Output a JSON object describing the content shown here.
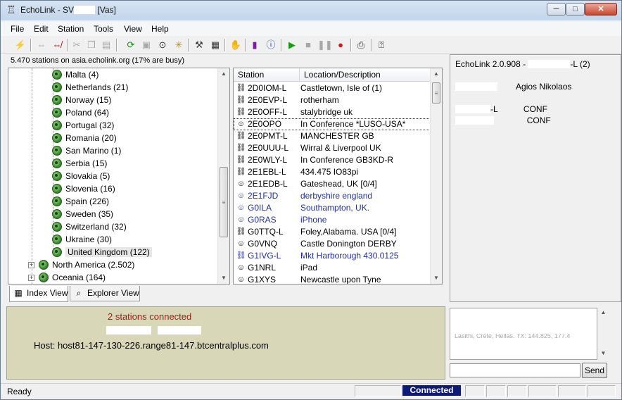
{
  "window": {
    "title_prefix": "EchoLink - SV",
    "title_suffix": "[Vas]",
    "minimize_glyph": "─",
    "maximize_glyph": "□",
    "close_glyph": "✕"
  },
  "menu": [
    "File",
    "Edit",
    "Station",
    "Tools",
    "View",
    "Help"
  ],
  "toolbar_icons": [
    "lightning-icon",
    "link-icon",
    "unlink-icon",
    "cut-icon",
    "copy-icon",
    "paste-icon",
    "refresh-icon",
    "station-info-icon",
    "binoculars-icon",
    "sun-icon",
    "tools-icon",
    "preferences-icon",
    "hand-icon",
    "bars-icon",
    "info-icon",
    "play-icon",
    "stop-icon",
    "pause-icon",
    "record-icon",
    "print-icon",
    "help-icon"
  ],
  "server_status": "5.470 stations on asia.echolink.org (17% are busy)",
  "tree": {
    "countries": [
      "Malta (4)",
      "Netherlands (21)",
      "Norway (15)",
      "Poland (64)",
      "Portugal (32)",
      "Romania (20)",
      "San Marino (1)",
      "Serbia (15)",
      "Slovakia (5)",
      "Slovenia (16)",
      "Spain (226)",
      "Sweden (35)",
      "Switzerland (32)",
      "Ukraine (30)",
      "United Kingdom (122)"
    ],
    "regions": [
      "North America (2.502)",
      "Oceania (164)"
    ]
  },
  "tabs": {
    "index": "Index View",
    "explorer": "Explorer View"
  },
  "stations": {
    "headers": {
      "station": "Station",
      "location": "Location/Description"
    },
    "rows": [
      {
        "call": "2D0IOM-L",
        "loc": "Castletown, Isle of  (1)",
        "type": "link"
      },
      {
        "call": "2E0EVP-L",
        "loc": "rotherham",
        "type": "link"
      },
      {
        "call": "2E0OFF-L",
        "loc": "stalybridge uk",
        "type": "link"
      },
      {
        "call": "2E0OPO",
        "loc": "In Conference *LUSO-USA*",
        "type": "user-busy"
      },
      {
        "call": "2E0PMT-L",
        "loc": "MANCHESTER GB",
        "type": "link"
      },
      {
        "call": "2E0UUU-L",
        "loc": "Wirral & Liverpool UK",
        "type": "link"
      },
      {
        "call": "2E0WLY-L",
        "loc": "In Conference GB3KD-R",
        "type": "link"
      },
      {
        "call": "2E1EBL-L",
        "loc": "434.475 IO83pi",
        "type": "link"
      },
      {
        "call": "2E1EDB-L",
        "loc": "Gateshead, UK [0/4]",
        "type": "user-busy"
      },
      {
        "call": "2E1FJD",
        "loc": "derbyshire  england",
        "type": "user"
      },
      {
        "call": "G0ILA",
        "loc": "Southampton, UK.",
        "type": "user"
      },
      {
        "call": "G0RAS",
        "loc": "iPhone",
        "type": "user"
      },
      {
        "call": "G0TTQ-L",
        "loc": "Foley,Alabama. USA [0/4]",
        "type": "link"
      },
      {
        "call": "G0VNQ",
        "loc": "Castle Donington DERBY",
        "type": "user-busy"
      },
      {
        "call": "G1IVG-L",
        "loc": "Mkt Harborough 430.0125",
        "type": "link-user"
      },
      {
        "call": "G1NRL",
        "loc": "iPad",
        "type": "user-busy"
      },
      {
        "call": "G1XYS",
        "loc": "Newcastle upon Tyne",
        "type": "user-busy"
      }
    ]
  },
  "info": {
    "version_prefix": "EchoLink 2.0.908 - ",
    "version_suffix": "-L (2)",
    "location": "Agios Nikolaos",
    "line3_suffix": "-L",
    "line3_status": "CONF",
    "line4_status": "CONF"
  },
  "connection": {
    "title": "2 stations connected",
    "host": "Host: host81-147-130-226.range81-147.btcentralplus.com"
  },
  "chat": {
    "fragment": "Lasithi, Crete, Hellas. TX: 144.825, 177.4",
    "send_label": "Send"
  },
  "statusbar": {
    "left": "Ready",
    "connected": "Connected"
  }
}
